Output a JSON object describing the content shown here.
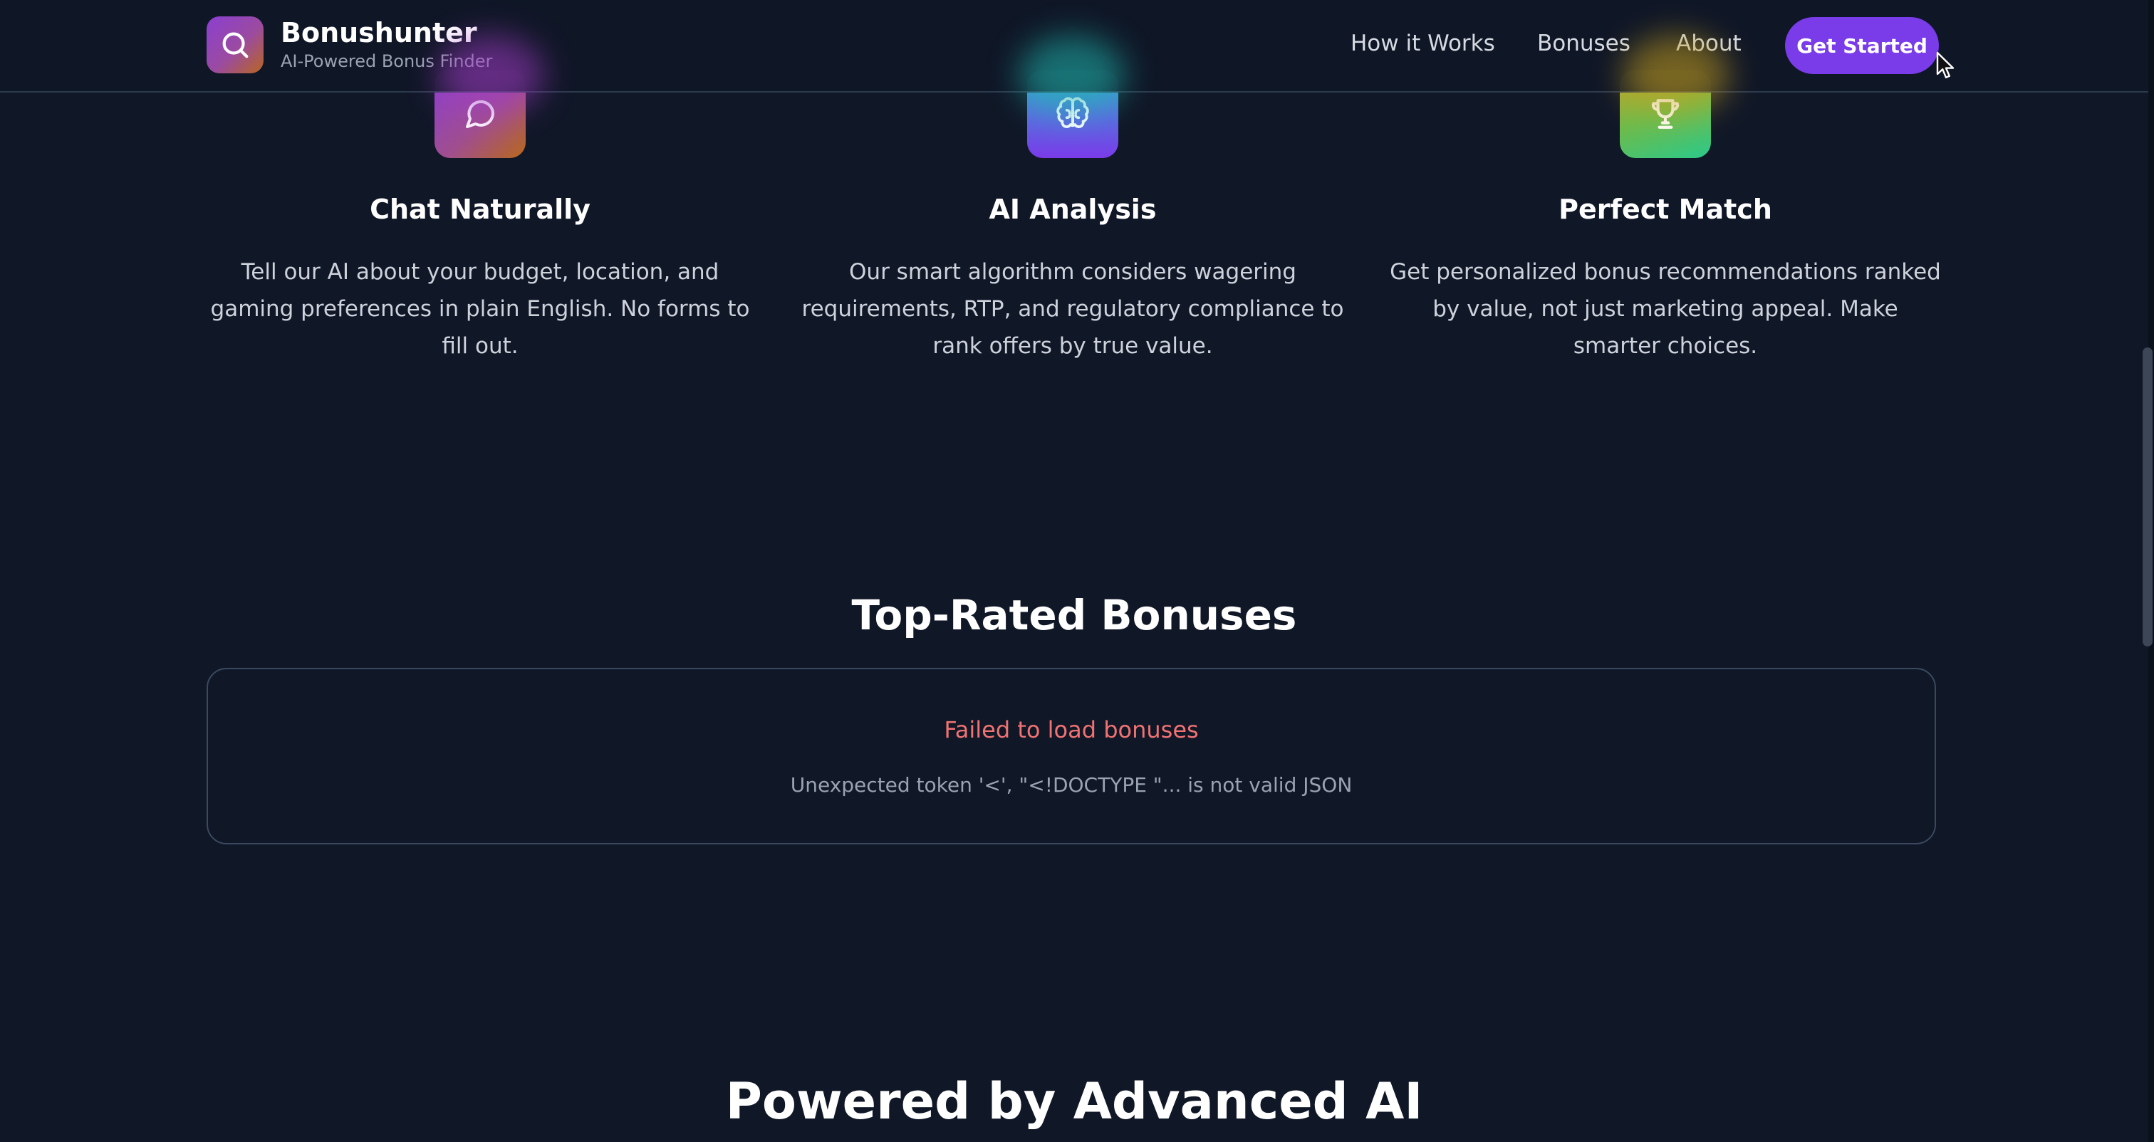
{
  "navbar": {
    "brand_name": "Bonushunter",
    "brand_tagline": "AI-Powered Bonus Finder",
    "links": [
      "How it Works",
      "Bonuses",
      "About"
    ],
    "cta_label": "Get Started"
  },
  "features": [
    {
      "icon": "chat-bubble-icon",
      "title": "Chat Naturally",
      "description": "Tell our AI about your budget, location, and gaming preferences in plain English. No forms to fill out."
    },
    {
      "icon": "brain-icon",
      "title": "AI Analysis",
      "description": "Our smart algorithm considers wagering requirements, RTP, and regulatory compliance to rank offers by true value."
    },
    {
      "icon": "trophy-icon",
      "title": "Perfect Match",
      "description": "Get personalized bonus recommendations ranked by value, not just marketing appeal. Make smarter choices."
    }
  ],
  "bonuses": {
    "title": "Top-Rated Bonuses",
    "error_title": "Failed to load bonuses",
    "error_detail": "Unexpected token '<', \"<!DOCTYPE \"... is not valid JSON"
  },
  "powered": {
    "title": "Powered by Advanced AI"
  },
  "colors": {
    "background": "#101727",
    "accent": "#7a3be9",
    "error": "#f07272"
  }
}
